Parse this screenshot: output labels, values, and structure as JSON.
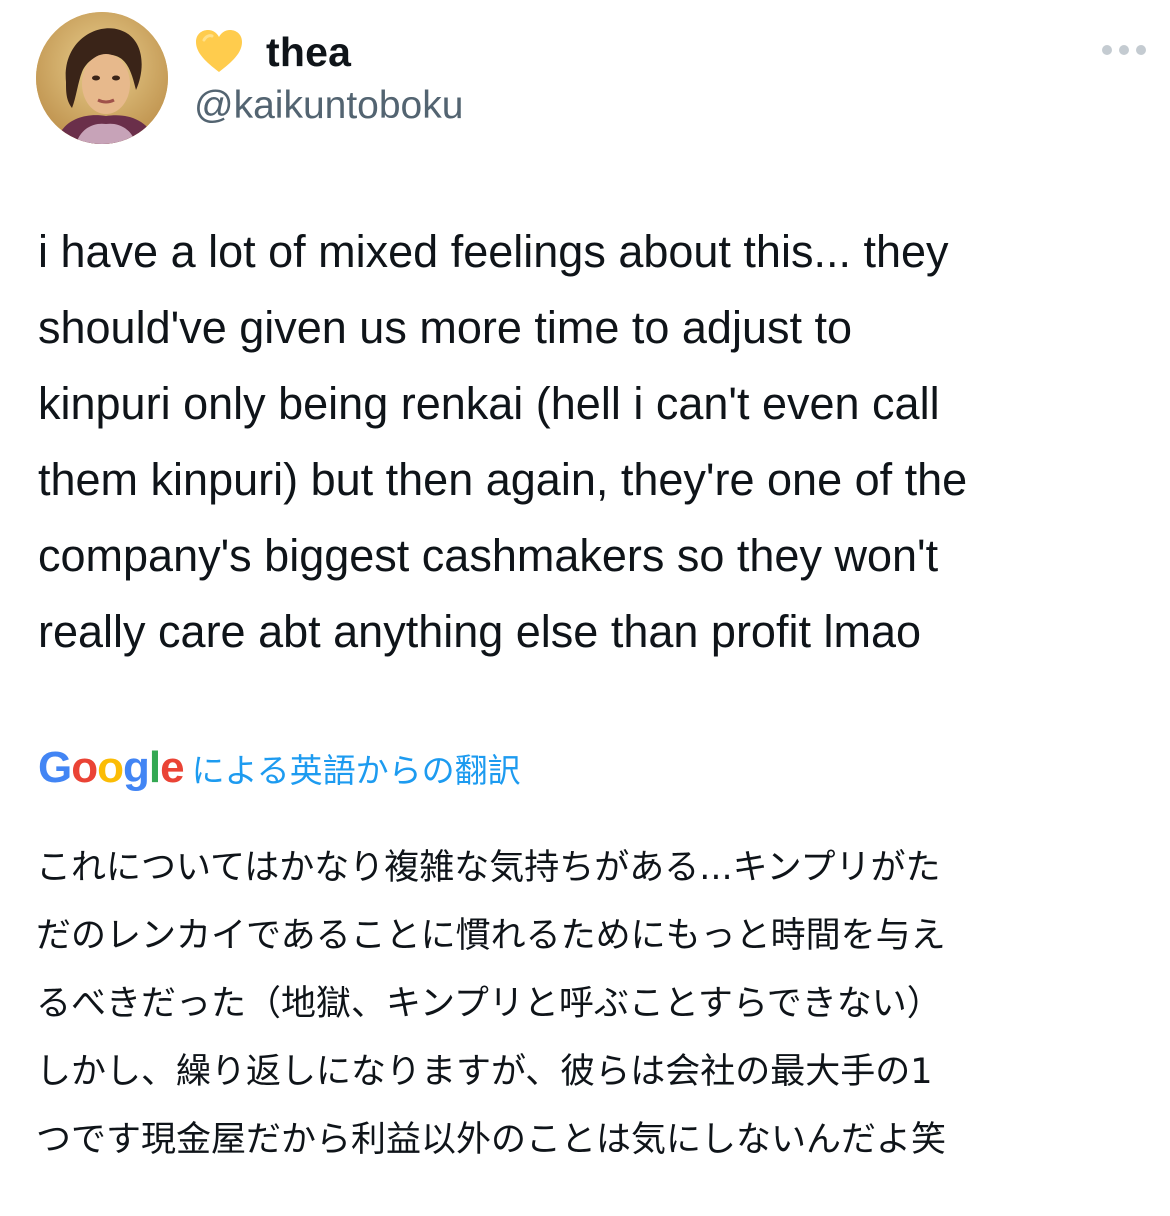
{
  "tweet": {
    "author": {
      "emoji": "yellow-heart",
      "display_name": "thea",
      "handle": "@kaikuntoboku"
    },
    "more_icon": "more-horizontal-icon",
    "text_lines": [
      "i have a lot of mixed feelings about this... they",
      "should've given us more time to adjust to",
      "kinpuri only being renkai (hell i can't even call",
      "them kinpuri) but then again, they're one of the",
      "company's biggest cashmakers so they won't",
      "really care abt anything else than profit lmao"
    ],
    "translation": {
      "provider": "Google",
      "label": "による英語からの翻訳",
      "text_lines": [
        "これについてはかなり複雑な気持ちがある...キンプリがた",
        "だのレンカイであることに慣れるためにもっと時間を与え",
        "るべきだった（地獄、キンプリと呼ぶことすらできない）",
        "しかし、繰り返しになりますが、彼らは会社の最大手の1",
        "つです現金屋だから利益以外のことは気にしないんだよ笑"
      ]
    }
  },
  "colors": {
    "text": "#0f1419",
    "secondary": "#536471",
    "link": "#1d9bf0",
    "heart": "#ffcc4d"
  }
}
